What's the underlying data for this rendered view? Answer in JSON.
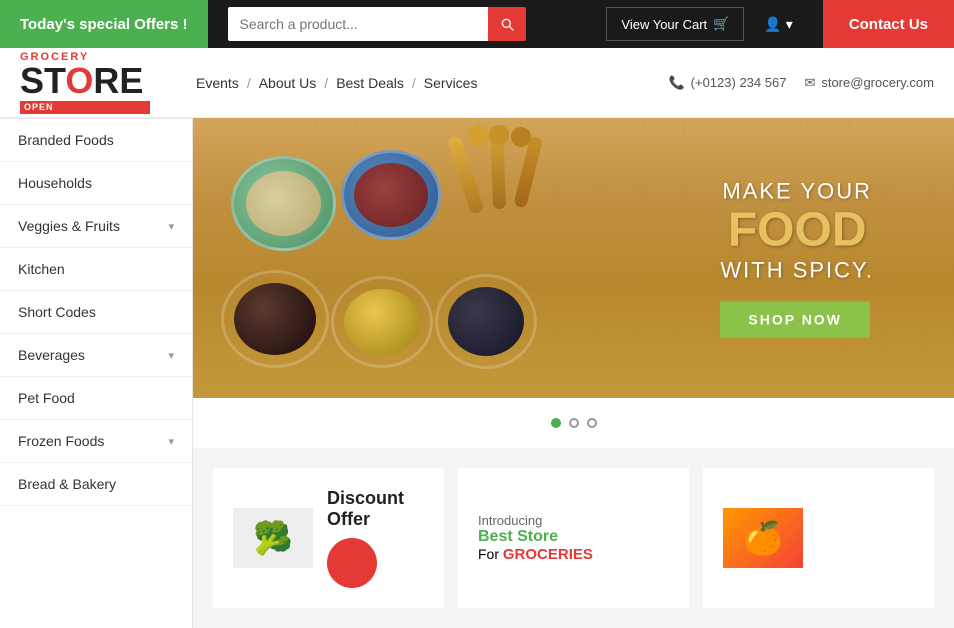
{
  "topbar": {
    "offer_text": "Today's special Offers !",
    "search_placeholder": "Search a product...",
    "cart_label": "View Your Cart",
    "contact_label": "Contact Us"
  },
  "header": {
    "logo_grocery": "GROCERY",
    "logo_store_prefix": "ST",
    "logo_store_highlight": "O",
    "logo_store_suffix": "RE",
    "logo_open": "OPEN",
    "nav": [
      {
        "label": "Events"
      },
      {
        "label": "About Us"
      },
      {
        "label": "Best Deals"
      },
      {
        "label": "Services"
      }
    ],
    "phone": "(+0123) 234 567",
    "email": "store@grocery.com"
  },
  "sidebar": {
    "items": [
      {
        "label": "Branded Foods",
        "has_arrow": false
      },
      {
        "label": "Households",
        "has_arrow": false
      },
      {
        "label": "Veggies & Fruits",
        "has_arrow": true
      },
      {
        "label": "Kitchen",
        "has_arrow": false
      },
      {
        "label": "Short Codes",
        "has_arrow": false
      },
      {
        "label": "Beverages",
        "has_arrow": true
      },
      {
        "label": "Pet Food",
        "has_arrow": false
      },
      {
        "label": "Frozen Foods",
        "has_arrow": true
      },
      {
        "label": "Bread & Bakery",
        "has_arrow": false
      }
    ]
  },
  "hero": {
    "line1": "MAKE YOUR",
    "line2": "FOOD",
    "line3": "WITH SPICY.",
    "cta": "SHOP NOW"
  },
  "carousel": {
    "dots": [
      {
        "active": true
      },
      {
        "active": false
      },
      {
        "active": false
      }
    ]
  },
  "cards": [
    {
      "title": "Discount Offer",
      "subtitle": ""
    },
    {
      "intro": "Introducing",
      "best_store": "Best Store",
      "for_text": "For",
      "groceries": "GROCERIES"
    }
  ]
}
